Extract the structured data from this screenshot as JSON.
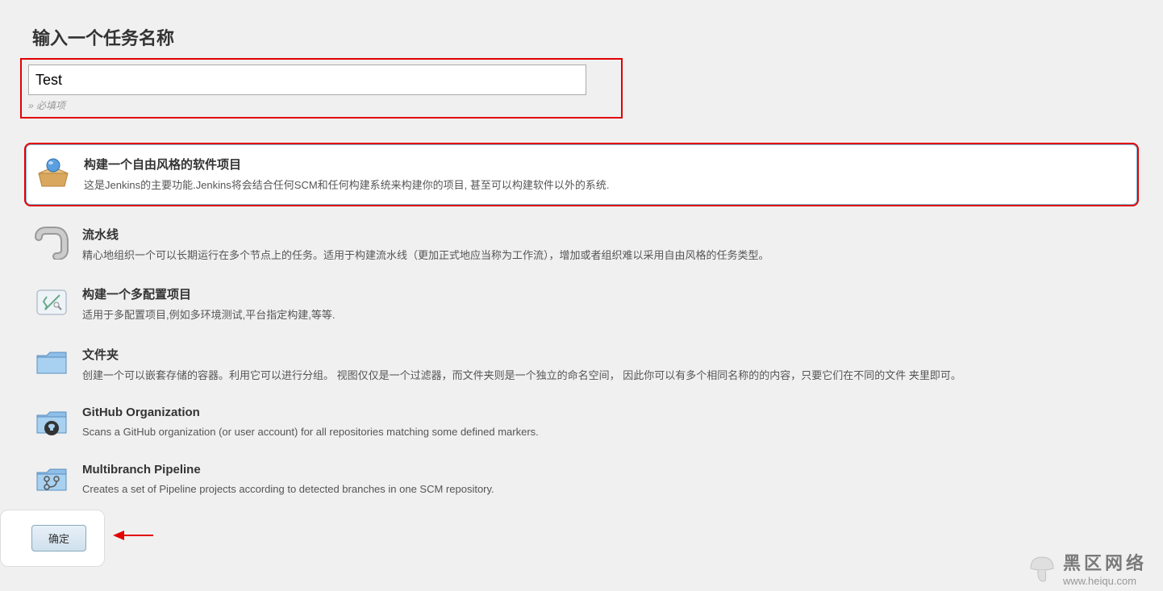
{
  "heading": "输入一个任务名称",
  "input_value": "Test",
  "required_text": "» 必填项",
  "options": [
    {
      "title": "构建一个自由风格的软件项目",
      "desc": "这是Jenkins的主要功能.Jenkins将会结合任何SCM和任何构建系统来构建你的项目, 甚至可以构建软件以外的系统."
    },
    {
      "title": "流水线",
      "desc": "精心地组织一个可以长期运行在多个节点上的任务。适用于构建流水线（更加正式地应当称为工作流），增加或者组织难以采用自由风格的任务类型。"
    },
    {
      "title": "构建一个多配置项目",
      "desc": "适用于多配置项目,例如多环境测试,平台指定构建,等等."
    },
    {
      "title": "文件夹",
      "desc": "创建一个可以嵌套存储的容器。利用它可以进行分组。 视图仅仅是一个过滤器，而文件夹则是一个独立的命名空间， 因此你可以有多个相同名称的的内容，只要它们在不同的文件 夹里即可。"
    },
    {
      "title": "GitHub Organization",
      "desc": "Scans a GitHub organization (or user account) for all repositories matching some defined markers."
    },
    {
      "title": "Multibranch Pipeline",
      "desc": "Creates a set of Pipeline projects according to detected branches in one SCM repository."
    }
  ],
  "ok_button": "确定",
  "watermark": {
    "title": "黑区网络",
    "url": "www.heiqu.com"
  }
}
